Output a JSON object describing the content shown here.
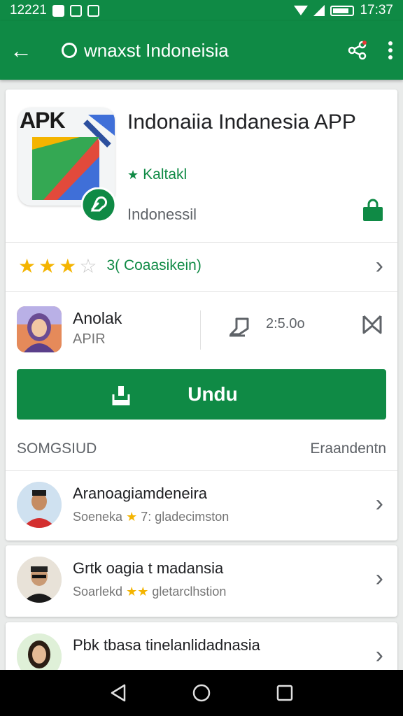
{
  "status_bar": {
    "left_time": "12221",
    "right_time": "17:37"
  },
  "app_bar": {
    "title": "wnaxst Indoneisia",
    "icons": [
      "back-arrow-icon",
      "search-icon",
      "share-icon",
      "more-vert-icon"
    ]
  },
  "app": {
    "icon_label": "APK",
    "name": "Indonaiia Indanesia APP",
    "developer": "Kaltakl",
    "category": "Indonessil"
  },
  "rating": {
    "stars": 3.5,
    "text": "3( Coaasikein)"
  },
  "meta": {
    "dev_name": "Anolak",
    "dev_sub": "APIR",
    "size": "2:5.0o"
  },
  "install": {
    "label": "Undu"
  },
  "section": {
    "left": "SOMGSIUD",
    "right": "Eraandentn"
  },
  "list": [
    {
      "title": "Aranoagiamdeneira",
      "sub_left": "Soeneka",
      "sub_stars": "★",
      "sub_right": "7: gladecimston"
    },
    {
      "title": "Grtk oagia t madansia",
      "sub_left": "Soarlekd",
      "sub_stars": "★★",
      "sub_right": "gletarclhstion"
    },
    {
      "title": "Pbk tbasa tinelanlidadnasia",
      "sub_left": "",
      "sub_stars": "",
      "sub_right": ""
    }
  ],
  "colors": {
    "brand": "#0f8a45",
    "star": "#f4b400"
  }
}
